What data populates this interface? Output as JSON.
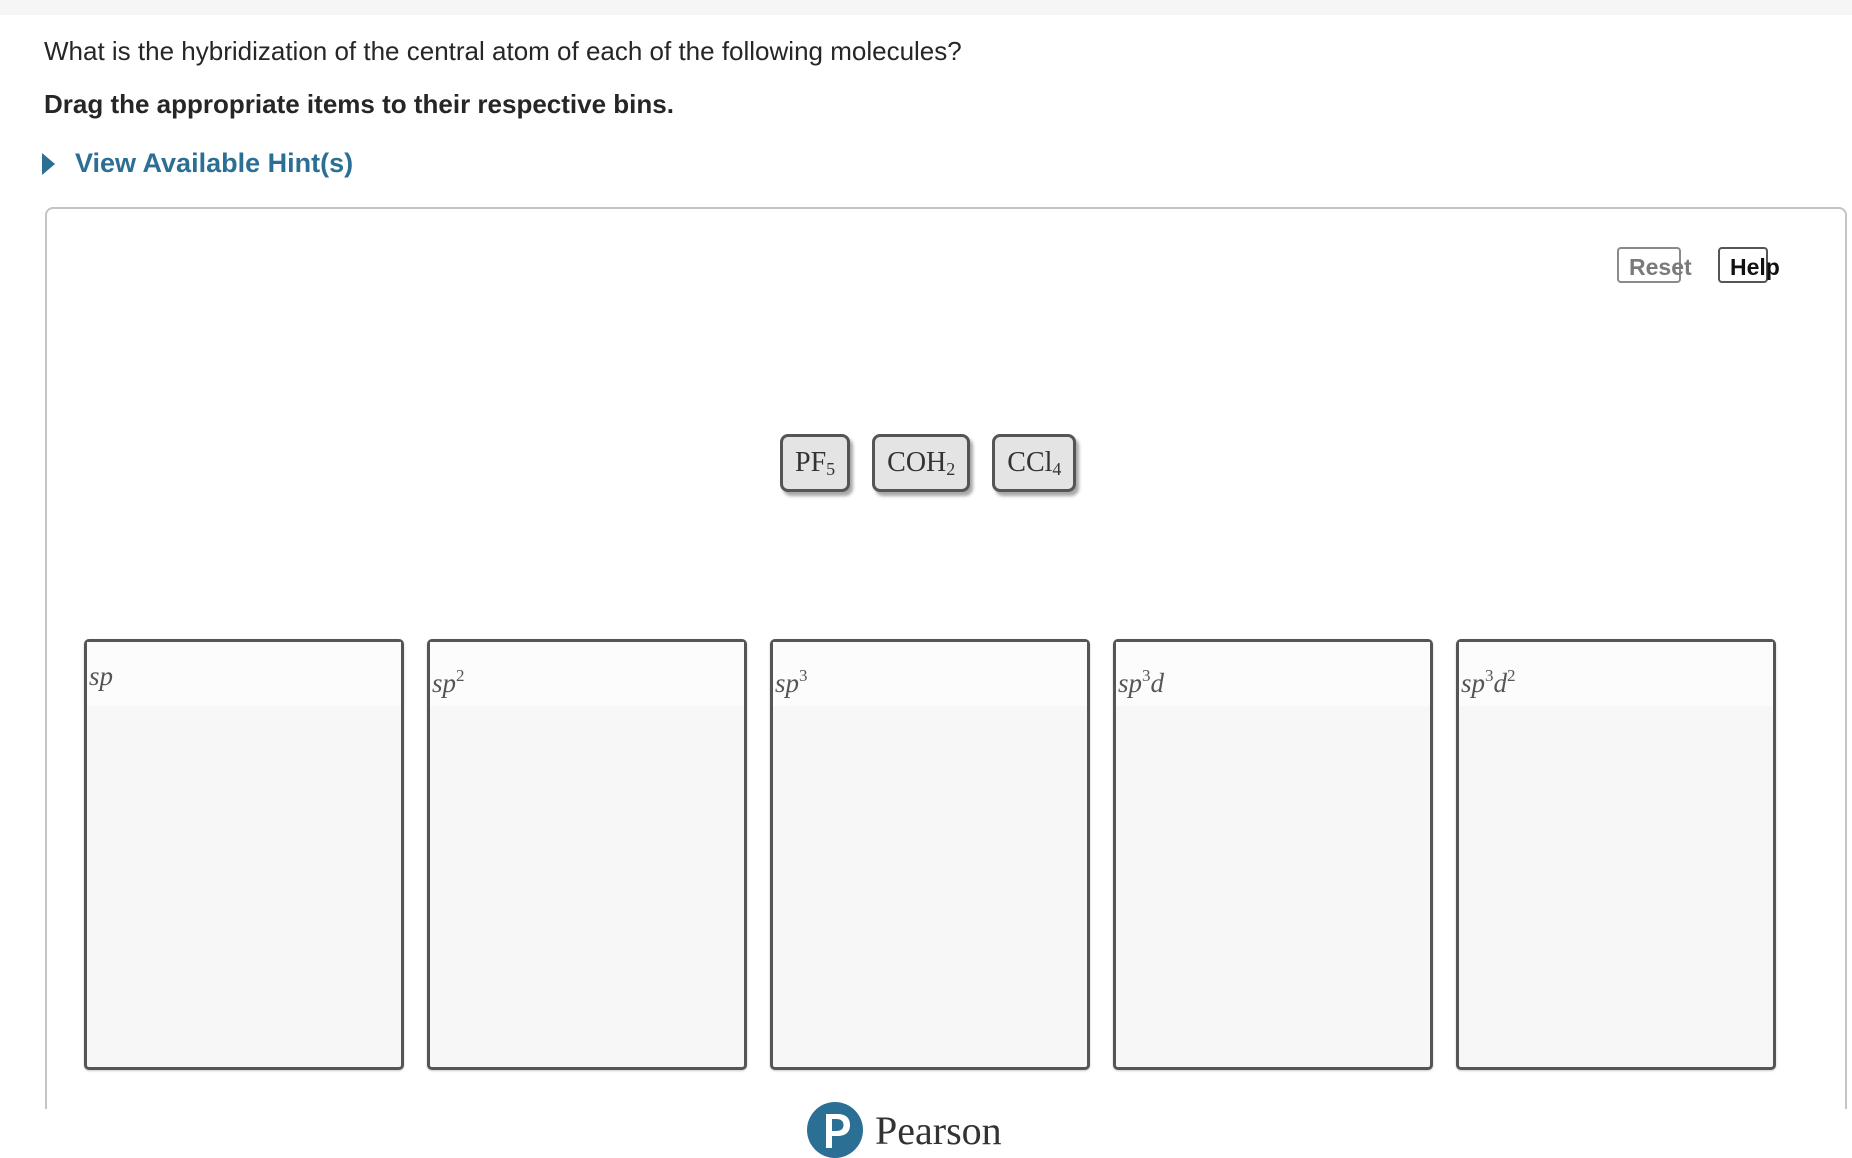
{
  "question": "What is the hybridization of the central atom of each of the following molecules?",
  "instruction": "Drag the appropriate items to their respective bins.",
  "hint_label": "View Available Hint(s)",
  "toolbar": {
    "reset_label": "Reset",
    "help_label": "Help"
  },
  "items": [
    {
      "base": "PF",
      "sub": "5"
    },
    {
      "base": "COH",
      "sub": "2"
    },
    {
      "base": "CCl",
      "sub": "4"
    }
  ],
  "bins": [
    {
      "base": "sp",
      "sup": "",
      "d": "",
      "dsup": ""
    },
    {
      "base": "sp",
      "sup": "2",
      "d": "",
      "dsup": ""
    },
    {
      "base": "sp",
      "sup": "3",
      "d": "",
      "dsup": ""
    },
    {
      "base": "sp",
      "sup": "3",
      "d": "d",
      "dsup": ""
    },
    {
      "base": "sp",
      "sup": "3",
      "d": "d",
      "dsup": "2"
    }
  ],
  "footer": {
    "brand": "Pearson"
  },
  "colors": {
    "accent": "#2c6f95",
    "bin_bg": "#f7f7f7",
    "item_bg": "#e4e4e4"
  },
  "icons": {
    "hint_toggle": "caret-right-icon",
    "brand_logo": "pearson-p-logo"
  }
}
